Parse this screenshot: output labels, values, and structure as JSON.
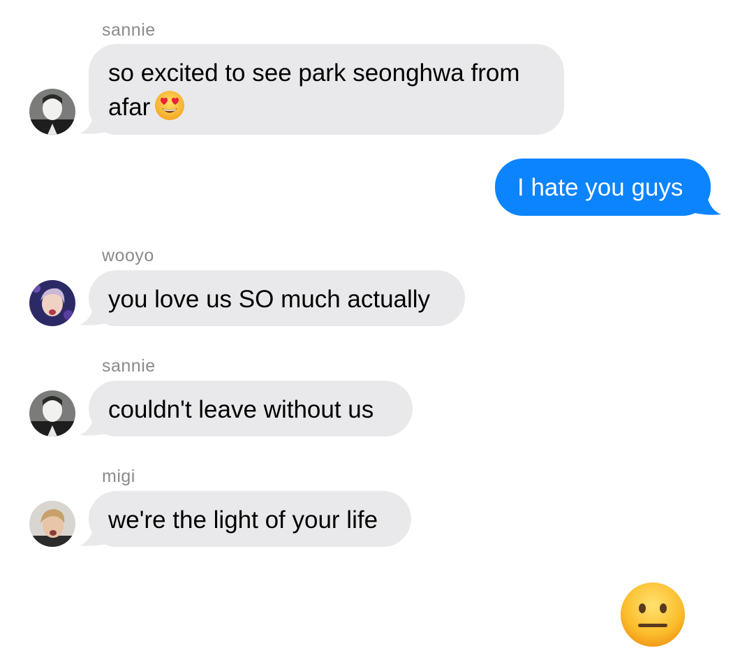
{
  "messages": [
    {
      "sender": "sannie",
      "text": "so excited to see park seonghwa from afar",
      "emoji": "heart-eyes"
    },
    {
      "sender": "me",
      "text": "I hate you guys"
    },
    {
      "sender": "wooyo",
      "text": "you love us SO much actually"
    },
    {
      "sender": "sannie",
      "text": "couldn't leave without us"
    },
    {
      "sender": "migi",
      "text": "we're the light of your life"
    },
    {
      "sender": "me",
      "emoji": "neutral-face"
    }
  ],
  "colors": {
    "incoming_bubble": "#e9e9eb",
    "outgoing_bubble": "#0b84fe",
    "sender_label": "#8a8a8e"
  }
}
